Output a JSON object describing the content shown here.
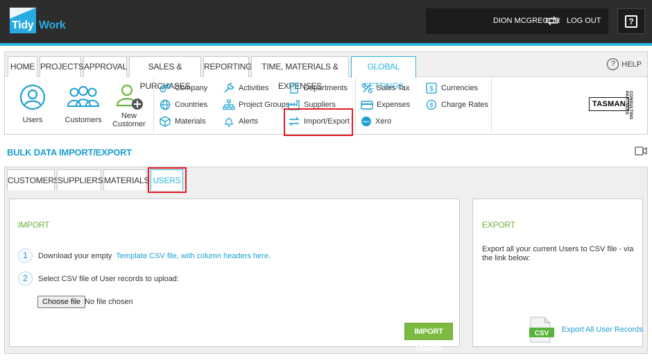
{
  "header": {
    "logo_tidy": "Tidy",
    "logo_work": "Work",
    "user_name": "DION MCGREGOR",
    "logout_label": "LOG OUT",
    "help_glyph": "?"
  },
  "main_tabs": [
    {
      "label": "HOME",
      "active": false
    },
    {
      "label": "PROJECTS",
      "active": false
    },
    {
      "label": "APPROVAL",
      "active": false
    },
    {
      "label": "SALES & PURCHASES",
      "active": false
    },
    {
      "label": "REPORTING",
      "active": false
    },
    {
      "label": "TIME, MATERIALS & EXPENSES",
      "active": false
    },
    {
      "label": "GLOBAL SETTINGS",
      "active": true
    }
  ],
  "help_label": "HELP",
  "settings_menu": {
    "big_items": [
      {
        "label": "Users",
        "icon": "user-icon"
      },
      {
        "label": "Customers",
        "icon": "customers-icon"
      },
      {
        "label": "New",
        "label2": "Customer",
        "icon": "add-customer-icon"
      }
    ],
    "col1": [
      {
        "label": "Company",
        "icon": "gears-icon"
      },
      {
        "label": "Countries",
        "icon": "globe-icon"
      },
      {
        "label": "Materials",
        "icon": "cube-icon"
      }
    ],
    "col2": [
      {
        "label": "Activities",
        "icon": "wrench-icon"
      },
      {
        "label": "Project Groups",
        "icon": "hierarchy-icon"
      },
      {
        "label": "Alerts",
        "icon": "bell-icon"
      }
    ],
    "col3": [
      {
        "label": "Departments",
        "icon": "building-icon"
      },
      {
        "label": "Suppliers",
        "icon": "factory-icon"
      },
      {
        "label": "Import/Export",
        "icon": "arrows-icon"
      }
    ],
    "col4": [
      {
        "label": "Sales Tax",
        "icon": "percent-icon"
      },
      {
        "label": "Expenses",
        "icon": "card-icon"
      },
      {
        "label": "Xero",
        "icon": "xero-icon"
      }
    ],
    "col5": [
      {
        "label": "Currencies",
        "icon": "dollar-icon"
      },
      {
        "label": "Charge Rates",
        "icon": "coin-icon"
      }
    ]
  },
  "partner_logo": {
    "main": "TASMAN",
    "sub": "CONSULTING PARTNERS"
  },
  "page_title": "BULK DATA IMPORT/EXPORT",
  "sub_tabs": [
    {
      "label": "CUSTOMERS",
      "active": false
    },
    {
      "label": "SUPPLIERS",
      "active": false
    },
    {
      "label": "MATERIALS",
      "active": false
    },
    {
      "label": "USERS",
      "active": true
    }
  ],
  "import": {
    "title": "IMPORT",
    "step1_num": "1",
    "step1_text": "Download your empty ",
    "step1_link": "Template CSV file, with column headers here.",
    "step2_num": "2",
    "step2_text": "Select CSV file of User records to upload:",
    "choose_file": "Choose file",
    "no_file": "No file chosen",
    "button": "IMPORT USERS"
  },
  "export": {
    "title": "EXPORT",
    "text": "Export all your current Users to CSV file - via the link below:",
    "csv_badge": "CSV",
    "link": "Export All User Records"
  },
  "colors": {
    "accent": "#2bb3e0",
    "green": "#7cbb3f",
    "highlight": "#e11b22"
  }
}
